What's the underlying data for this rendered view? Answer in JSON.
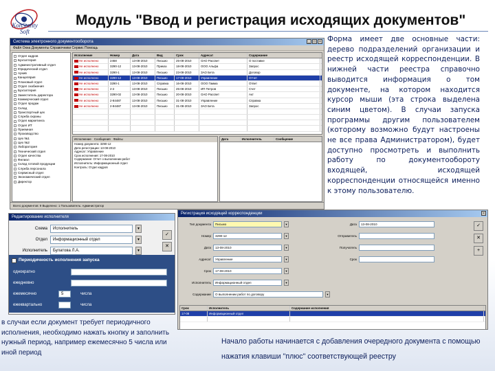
{
  "slide": {
    "title": "Модуль \"Ввод и регистрация исходящих документов\"",
    "logo_text": [
      "KonStanty",
      "Soft"
    ],
    "description": "Форма имеет две основные части: дерево подразделений организации и реестр исходящей корреспонденции. В нижней части реестра справочно выводится информация о том документе, на котором находится курсор мыши (эта строка выделена синим цветом). В случаи запуска программы другим пользователем (которому возможно будут настроены не все права Администратором), будет доступно просмотреть и выполнить работу по документообороту входящей, исходящей корреспонденции относящейся именно к этому пользователю.",
    "caption_left": "в случаи если документ требует периодичного исполнения, необходимо нажать кнопку и заполнить нужный период, например ежемесячно 5 числа или иной период",
    "caption_right": "Начало работы начинается с добавления очередного документа с помощью нажатия клавиши \"плюс\" соответствующей реестру",
    "colors": {
      "title_rule": "#6b86b8",
      "text_blue": "#0b1d5a",
      "selection": "#1f3fa8",
      "red_flag": "#c00000",
      "band_blue": "#2d4e86"
    }
  },
  "window_main": {
    "title": "Система электронного документооборота",
    "menu": "Файл  Окна  Документы  Справочники  Сервис  Помощь",
    "tree": [
      "Отдел кадров",
      "Бухгалтерия",
      "Административный отдел",
      "Юридический отдел",
      "Архив",
      "Канцелярия",
      "Плановый отдел",
      "Отдел снабжения",
      "Бухгалтерия",
      "Заместитель директора",
      "Коммерческий отдел",
      "Отдел продаж",
      "Склад",
      "Транспортный цех",
      "Служба охраны",
      "Отдел маркетинга",
      "Отдел ИТ",
      "Приемная",
      "Производство",
      "Цех №1",
      "Цех №2",
      "Лаборатория",
      "Технический отдел",
      "Отдел качества",
      "Филиал",
      "Склад готовой продукции",
      "Служба персонала",
      "Сервисный отдел",
      "Экономический отдел",
      "Директор"
    ],
    "grid_headers": [
      "Исполнение",
      "Номер",
      "Дата",
      "Вид",
      "Срок",
      "Адресат",
      "Содержание"
    ],
    "grid_rows": [
      [
        "Не исполнено",
        "2468",
        "13-08-2010",
        "Письмо",
        "25-08-2010",
        "ОАО Рассвет",
        "О поставке"
      ],
      [
        "Не исполнено",
        "3290-12",
        "13-08-2010",
        "Приказ",
        "18-08-2010",
        "ООО Альфа",
        "Запрос"
      ],
      [
        "Не исполнено",
        "3290-1",
        "13-08-2010",
        "Письмо",
        "23-08-2010",
        "ЗАО Бета",
        "Договор"
      ],
      [
        "Не исполнено",
        "3290-12",
        "13-08-2010",
        "Письмо",
        "17-08-2010",
        "Управление",
        "Отчет"
      ],
      [
        "Не исполнено",
        "3290-1",
        "13-08-2010",
        "Справка",
        "16-08-2010",
        "ООО Гамма",
        "Ответ"
      ],
      [
        "Не исполнено",
        "2-2",
        "13-08-2010",
        "Письмо",
        "25-08-2010",
        "ИП Петров",
        "Счет"
      ],
      [
        "Не исполнено",
        "3290-02",
        "13-08-2010",
        "Письмо",
        "20-08-2010",
        "ОАО Рассвет",
        "Акт"
      ],
      [
        "Не исполнено",
        "2-84487",
        "13-08-2010",
        "Письмо",
        "31-08-2010",
        "Управление",
        "Справка"
      ],
      [
        "Не исполнено",
        "2-84487",
        "13-08-2010",
        "Письмо",
        "31-08-2010",
        "ЗАО Бета",
        "Запрос"
      ],
      [
        "",
        "",
        "",
        "",
        "",
        "",
        ""
      ],
      [
        "",
        "",
        "",
        "",
        "",
        "",
        ""
      ],
      [
        "",
        "",
        "",
        "",
        "",
        "",
        ""
      ],
      [
        "",
        "",
        "",
        "",
        "",
        "",
        ""
      ]
    ],
    "selected_row": 3,
    "detail_tabs": [
      "Исполнение",
      "Сообщения",
      "Файлы"
    ],
    "detail_lines": [
      "Номер документа: 3290-12",
      "Дата регистрации: 13-08-2010",
      "Адресат: Управление",
      "Срок исполнения: 17-08-2010",
      "Содержание: Отчет о выполнении работ",
      "Исполнитель: Информационный отдел",
      "Контроль: Отдел кадров"
    ],
    "right_headers": [
      "Дата",
      "Исполнитель",
      "Сообщение"
    ],
    "status": "Всего документов: 9     Выделено: 1     Пользователь: Администратор"
  },
  "window_period": {
    "title": "Редактирование исполнителя",
    "fields": [
      {
        "label": "Схема",
        "value": "Исполнитель"
      },
      {
        "label": "Отдел",
        "value": "Информационный отдел"
      },
      {
        "label": "Исполнитель",
        "value": "Булатова Л.А."
      }
    ],
    "band_header": "Периодичность исполнения запуска",
    "band_labels": [
      "однократно",
      "ежедневно",
      "ежемесячно",
      "ежеквартально",
      "числа",
      "числа"
    ],
    "monthly_day": "5"
  },
  "window_doc": {
    "title": "Регистрация исходящей корреспонденции",
    "fields": [
      {
        "label": "Тип документа",
        "value": "Письмо",
        "yellow": true
      },
      {
        "label": "Номер",
        "value": "3290-12",
        "yellow": false
      },
      {
        "label": "Дата",
        "value": "13-08-2010",
        "yellow": false
      },
      {
        "label": "Адресат",
        "value": "Управление",
        "yellow": false
      },
      {
        "label": "Срок",
        "value": "17-08-2010",
        "yellow": false
      },
      {
        "label": "Исполнитель",
        "value": "Информационный отдел",
        "yellow": false
      },
      {
        "label": "Содержание",
        "value": "О выполнении работ по договору",
        "yellow": false
      }
    ],
    "right_fields": [
      {
        "label": "Дата",
        "value": "13-08-2010"
      },
      {
        "label": "Отправитель",
        "value": ""
      },
      {
        "label": "Получатель",
        "value": ""
      },
      {
        "label": "Срок",
        "value": ""
      }
    ],
    "grid_headers": [
      "Срок",
      "Исполнитель",
      "Содержание исполнения"
    ],
    "grid_rows": [
      [
        "17-08",
        "Информационный отдел",
        ""
      ],
      [
        "",
        "",
        ""
      ]
    ]
  }
}
